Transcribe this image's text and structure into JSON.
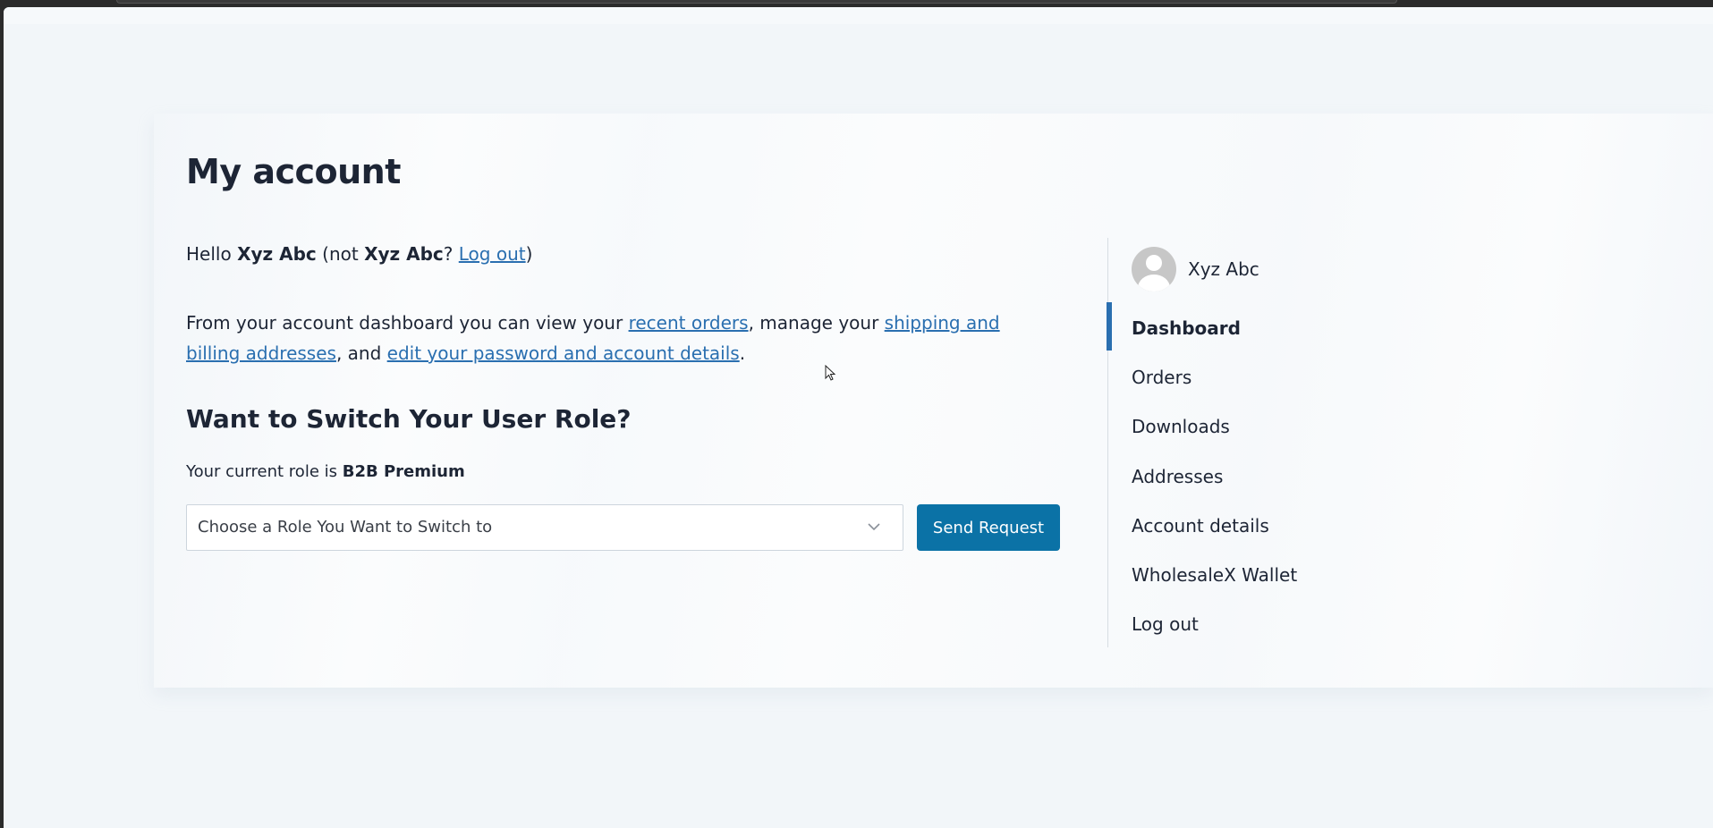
{
  "page": {
    "title": "My account"
  },
  "greeting": {
    "hello": "Hello",
    "user_name": "Xyz Abc",
    "not_open": "(not",
    "not_name": "Xyz Abc",
    "question": "?",
    "logout_link": "Log out",
    "close": ")"
  },
  "intro": {
    "part1": "From your account dashboard you can view your",
    "recent_orders_link": "recent orders",
    "part2": ", manage your",
    "addresses_link": "shipping and billing addresses",
    "part3": ", and",
    "account_link": "edit your password and account details",
    "part4": "."
  },
  "role_switch": {
    "title": "Want to Switch Your User Role?",
    "current_label": "Your current role is",
    "current_role": "B2B Premium",
    "select_placeholder": "Choose a Role You Want to Switch to",
    "send_button": "Send Request"
  },
  "sidebar": {
    "profile_name": "Xyz Abc",
    "items": [
      {
        "label": "Dashboard",
        "active": true
      },
      {
        "label": "Orders"
      },
      {
        "label": "Downloads"
      },
      {
        "label": "Addresses"
      },
      {
        "label": "Account details"
      },
      {
        "label": "WholesaleX Wallet"
      },
      {
        "label": "Log out"
      }
    ]
  },
  "colors": {
    "link": "#2a6fb0",
    "button": "#0b72a6",
    "text": "#1d2535",
    "active_bar": "#2a6fb0"
  }
}
